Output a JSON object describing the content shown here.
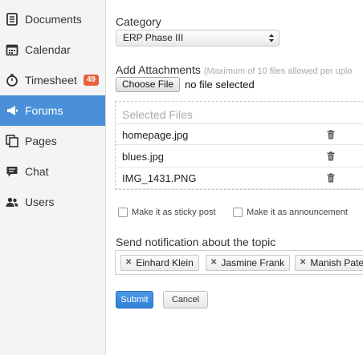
{
  "sidebar": {
    "items": [
      {
        "label": "Documents",
        "icon": "document-icon"
      },
      {
        "label": "Calendar",
        "icon": "calendar-icon"
      },
      {
        "label": "Timesheet",
        "icon": "timer-icon",
        "badge": "49"
      },
      {
        "label": "Forums",
        "icon": "megaphone-icon",
        "active": true
      },
      {
        "label": "Pages",
        "icon": "pages-icon"
      },
      {
        "label": "Chat",
        "icon": "chat-icon"
      },
      {
        "label": "Users",
        "icon": "users-icon"
      }
    ]
  },
  "form": {
    "category_label": "Category",
    "category_value": "ERP Phase III",
    "attachments_label": "Add Attachments",
    "attachments_hint": "(Maximum of 10 files allowed per uplo",
    "choose_file": "Choose File",
    "no_file": "no file selected",
    "selected_files_title": "Selected Files",
    "files": [
      "homepage.jpg",
      "blues.jpg",
      "IMG_1431.PNG"
    ],
    "sticky_label": "Make it as sticky post",
    "announcement_label": "Make it as announcement",
    "notify_label": "Send notification about the topic",
    "recipients": [
      "Einhard Klein",
      "Jasmine Frank",
      "Manish Pate"
    ],
    "submit": "Submit",
    "cancel": "Cancel"
  },
  "colors": {
    "accent": "#4a90d9",
    "badge": "#e8603c",
    "submit": "#3a8ae0"
  }
}
